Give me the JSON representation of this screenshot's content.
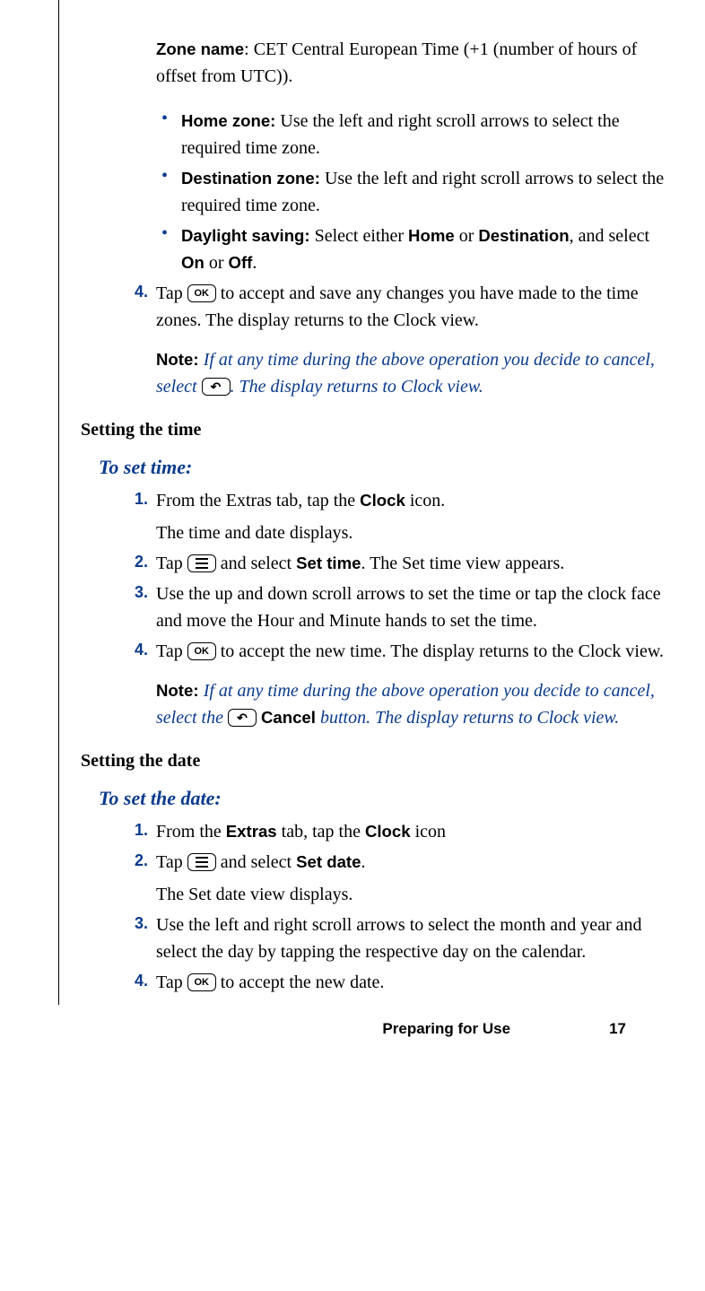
{
  "intro": {
    "zone_name_label": "Zone name",
    "zone_name_text": ": CET Central European Time (+1 (number of hours of offset from UTC))."
  },
  "bullets": [
    {
      "label": "Home zone:",
      "text": " Use the left and right scroll arrows to select the required time zone."
    },
    {
      "label": "Destination zone:",
      "text": " Use the left and right scroll arrows to select the required time zone."
    },
    {
      "label": "Daylight saving:",
      "text": " Select either ",
      "bold1": "Home",
      "mid": " or ",
      "bold2": "Destination",
      "after": ", and select ",
      "bold3": "On",
      "mid2": " or ",
      "bold4": "Off",
      "end": "."
    }
  ],
  "step4a_pre": "Tap ",
  "icon_ok": "OK",
  "step4a_post": " to accept and save any changes you have made to the time zones. The display returns to the Clock view.",
  "note_label": "Note:  ",
  "note1_pre": "If at any time during the above operation you decide to cancel, select ",
  "note1_post": ". The display returns to Clock view.",
  "heading_time": "Setting the time",
  "subhead_time": "To set time:",
  "time_steps": {
    "s1a": "From the Extras tab, tap the ",
    "s1_bold": "Clock",
    "s1b": " icon.",
    "s1c": "The time and date displays.",
    "s2a": "Tap ",
    "s2b": " and select ",
    "s2_bold": "Set time",
    "s2c": ". The Set time view appears.",
    "s3": "Use the up and down scroll arrows to set the time or tap the clock face and move the Hour and Minute hands to set the time.",
    "s4a": "Tap ",
    "s4b": " to accept the new time. The display returns to the Clock view."
  },
  "note2_pre": "If at any time during the above operation you decide to cancel, select the ",
  "note2_mid_bold": "Cancel",
  "note2_post": " button. The display returns to Clock view.",
  "heading_date": "Setting the date",
  "subhead_date": "To set the date:",
  "date_steps": {
    "s1a": "From the ",
    "s1_bold1": "Extras",
    "s1b": " tab, tap the ",
    "s1_bold2": "Clock",
    "s1c": " icon",
    "s2a": "Tap ",
    "s2b": " and select ",
    "s2_bold": "Set date",
    "s2c": ".",
    "s2d": "The Set date view displays.",
    "s3": "Use the left and right scroll arrows to select the month and year and select the day by tapping the respective day on the calendar.",
    "s4a": "Tap ",
    "s4b": " to accept the new date."
  },
  "nums": {
    "n1": "1.",
    "n2": "2.",
    "n3": "3.",
    "n4": "4."
  },
  "footer": {
    "label": "Preparing for Use",
    "page": "17"
  }
}
